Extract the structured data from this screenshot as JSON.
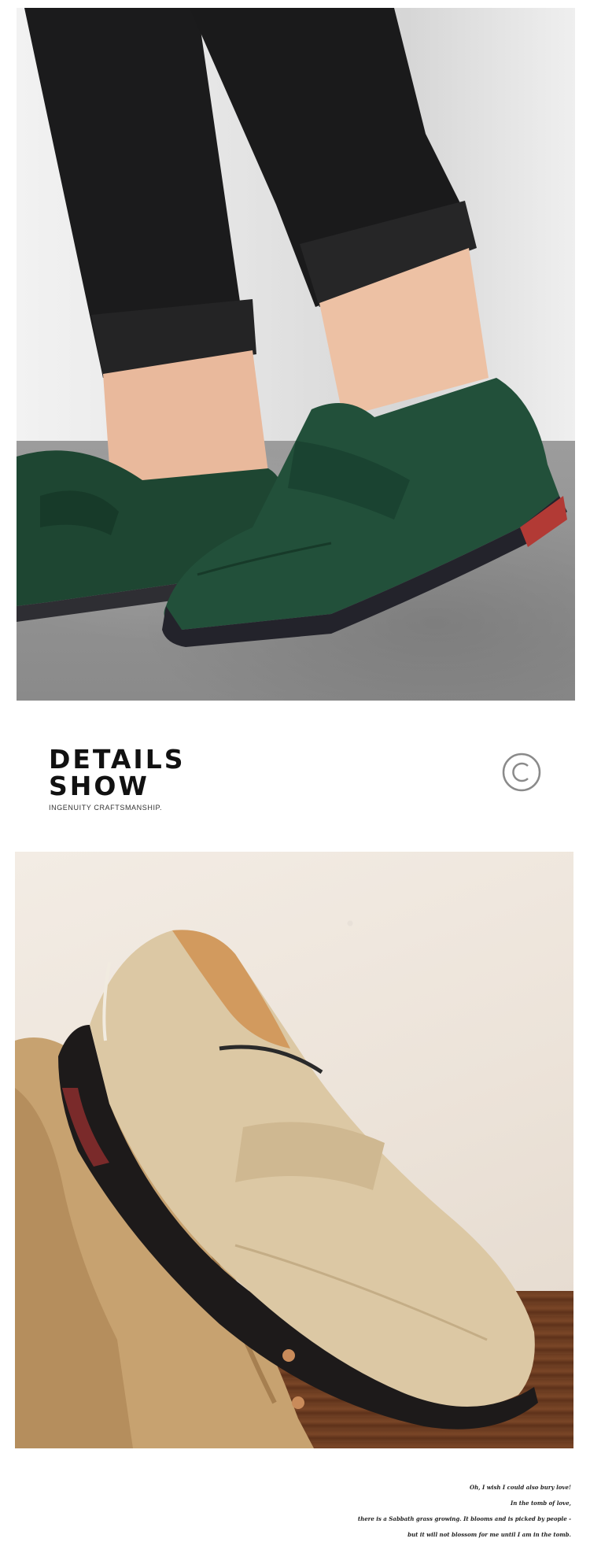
{
  "hero_image": {
    "label": "green-suede-penny-loafers-on-model"
  },
  "details": {
    "title": "DETAILS\nSHOW",
    "subtitle": "INGENUITY CRAFTSMANSHIP.",
    "mark_icon": "copyright-icon"
  },
  "product_image": {
    "label": "beige-suede-penny-loafer"
  },
  "poem": {
    "lines": [
      "Oh, I wish I could also bury love!",
      "In the tomb of love,",
      "there is a Sabbath grass growing. It blooms and is picked by people -",
      "but it will not blossom for me until I am in the tomb."
    ]
  },
  "colors": {
    "green_suede": "#1f4a33",
    "beige_suede": "#d9c6a3",
    "title_text": "#111111"
  }
}
